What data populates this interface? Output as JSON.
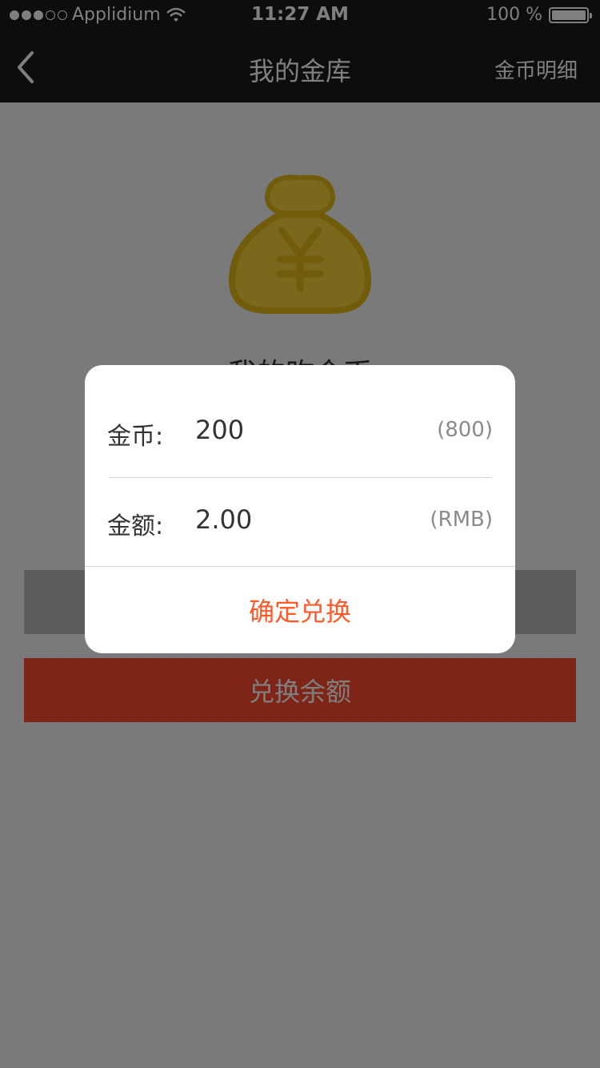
{
  "status_bar": {
    "carrier": "Applidium",
    "time": "11:27 AM",
    "battery": "100 %",
    "signal_bars_filled": 3,
    "signal_bars_total": 5
  },
  "nav": {
    "title": "我的金库",
    "right_label": "金币明细",
    "back_icon": "chevron-left-icon"
  },
  "main": {
    "bag_icon": "money-bag-yen-icon",
    "gold_label": "我的昨金币",
    "exchange_button": "兑换余额"
  },
  "dialog": {
    "gold_label": "金币:",
    "gold_value": "200",
    "gold_hint": "(800)",
    "amount_label": "金额:",
    "amount_value": "2.00",
    "amount_hint": "(RMB)",
    "confirm_button": "确定兑换"
  },
  "colors": {
    "accent": "#ff4a2e",
    "confirm_text": "#ff5a2a",
    "bag_gold": "#f4d23a"
  }
}
